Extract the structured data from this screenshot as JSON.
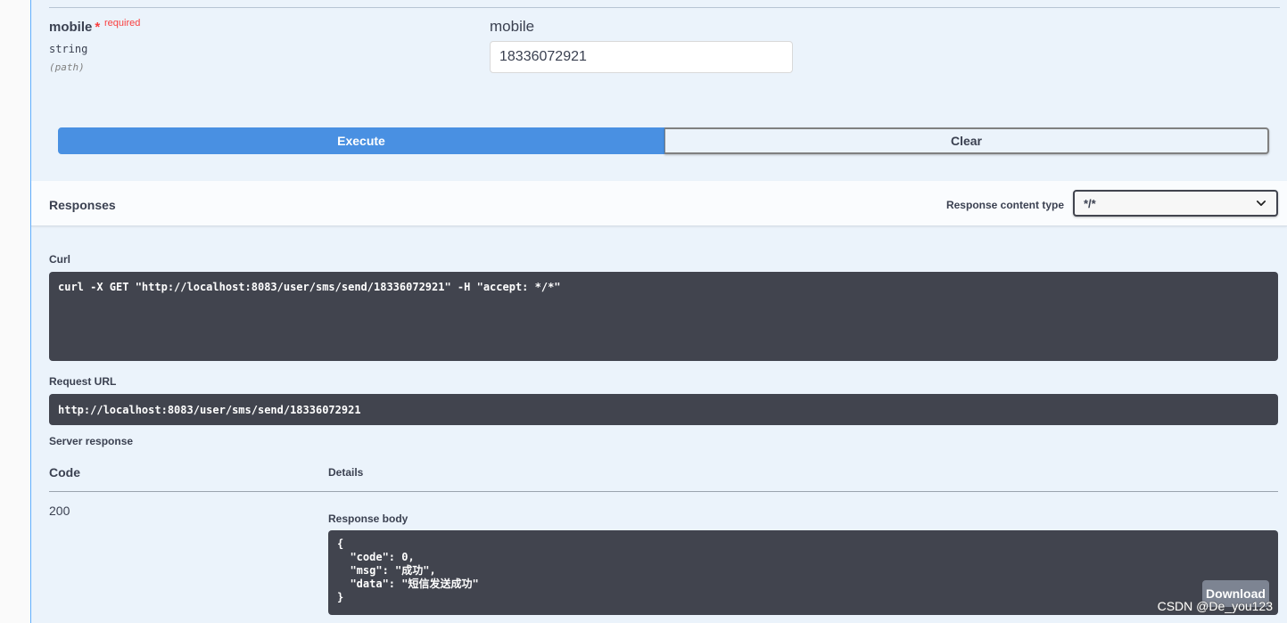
{
  "parameter": {
    "name": "mobile",
    "star": "*",
    "required_label": "required",
    "type": "string",
    "in": "(path)",
    "field_label": "mobile",
    "value": "18336072921"
  },
  "buttons": {
    "execute": "Execute",
    "clear": "Clear",
    "download": "Download"
  },
  "responses": {
    "title": "Responses",
    "content_type_label": "Response content type",
    "content_type_value": "*/*"
  },
  "curl": {
    "label": "Curl",
    "command": "curl -X GET \"http://localhost:8083/user/sms/send/18336072921\" -H \"accept: */*\""
  },
  "request_url": {
    "label": "Request URL",
    "value": "http://localhost:8083/user/sms/send/18336072921"
  },
  "server_response": {
    "label": "Server response",
    "col_code": "Code",
    "col_details": "Details",
    "code": "200",
    "body_label": "Response body",
    "body": "{\n  \"code\": 0,\n  \"msg\": \"成功\",\n  \"data\": \"短信发送成功\"\n}"
  },
  "watermark": "CSDN @De_you123",
  "colors": {
    "execute": "#4990e2",
    "panel": "#ebf3fb",
    "code_bg": "#41444e",
    "required": "#f93e3e"
  }
}
